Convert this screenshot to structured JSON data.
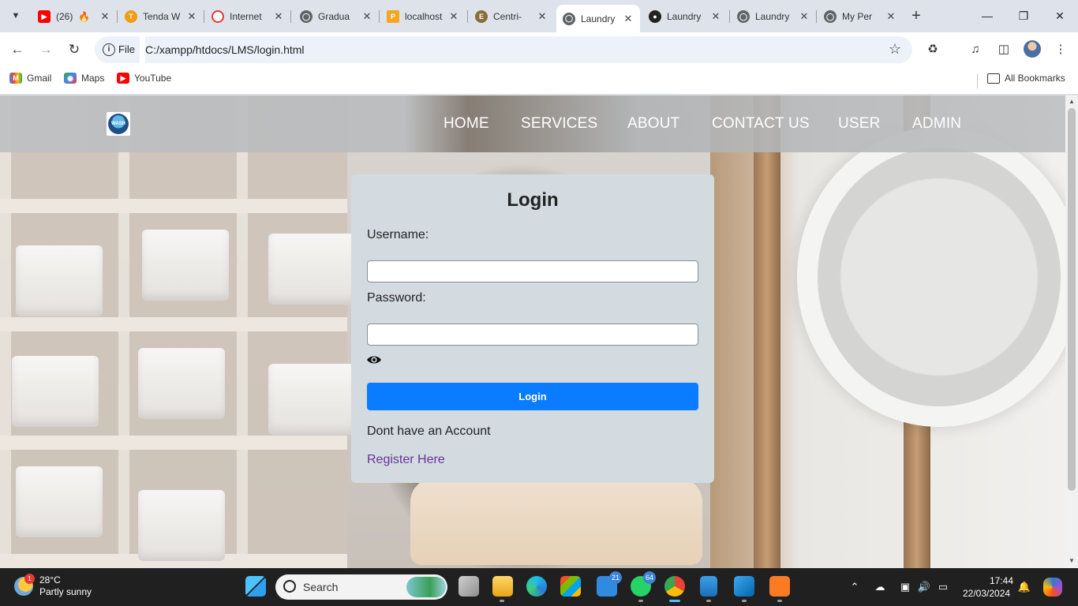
{
  "browser": {
    "tabs": [
      {
        "title": "(26)",
        "icon": "youtube-icon",
        "color": "#ff0000"
      },
      {
        "title": "Tenda W",
        "icon": "tenda-icon",
        "color": "#f39c12"
      },
      {
        "title": "Internet",
        "icon": "speedometer-icon",
        "color": "#e53935"
      },
      {
        "title": "Gradua",
        "icon": "globe-icon",
        "color": "#5f6368"
      },
      {
        "title": "localhost",
        "icon": "phpmyadmin-icon",
        "color": "#f4a623"
      },
      {
        "title": "Centri-",
        "icon": "elephant-icon",
        "color": "#8a6d3b"
      },
      {
        "title": "Laundry",
        "icon": "globe-icon",
        "color": "#5f6368",
        "active": true
      },
      {
        "title": "Laundry",
        "icon": "github-icon",
        "color": "#222222"
      },
      {
        "title": "Laundry",
        "icon": "globe-icon",
        "color": "#5f6368"
      },
      {
        "title": "My Per",
        "icon": "globe-icon",
        "color": "#5f6368"
      }
    ],
    "address": {
      "scheme": "File",
      "url": "C:/xampp/htdocs/LMS/login.html"
    },
    "bookmarks": [
      {
        "label": "Gmail",
        "icon": "gmail-icon"
      },
      {
        "label": "Maps",
        "icon": "maps-icon"
      },
      {
        "label": "YouTube",
        "icon": "youtube-icon"
      }
    ],
    "all_bookmarks": "All Bookmarks"
  },
  "site": {
    "logo_text": "WASH",
    "nav": [
      "HOME",
      "SERVICES",
      "ABOUT",
      "CONTACT US",
      "USER",
      "ADMIN"
    ]
  },
  "login": {
    "title": "Login",
    "username_label": "Username:",
    "username_value": "",
    "password_label": "Password:",
    "password_value": "",
    "button": "Login",
    "no_account": "Dont have an Account",
    "register_link": "Register Here"
  },
  "taskbar": {
    "weather": {
      "temp": "28°C",
      "desc": "Partly sunny",
      "badge": "1"
    },
    "search_placeholder": "Search",
    "mail_count": "21",
    "whatsapp_count": "64",
    "time": "17:44",
    "date": "22/03/2024"
  },
  "colors": {
    "accent": "#0a7cff",
    "link": "#663399",
    "card": "#d3dbe1"
  }
}
